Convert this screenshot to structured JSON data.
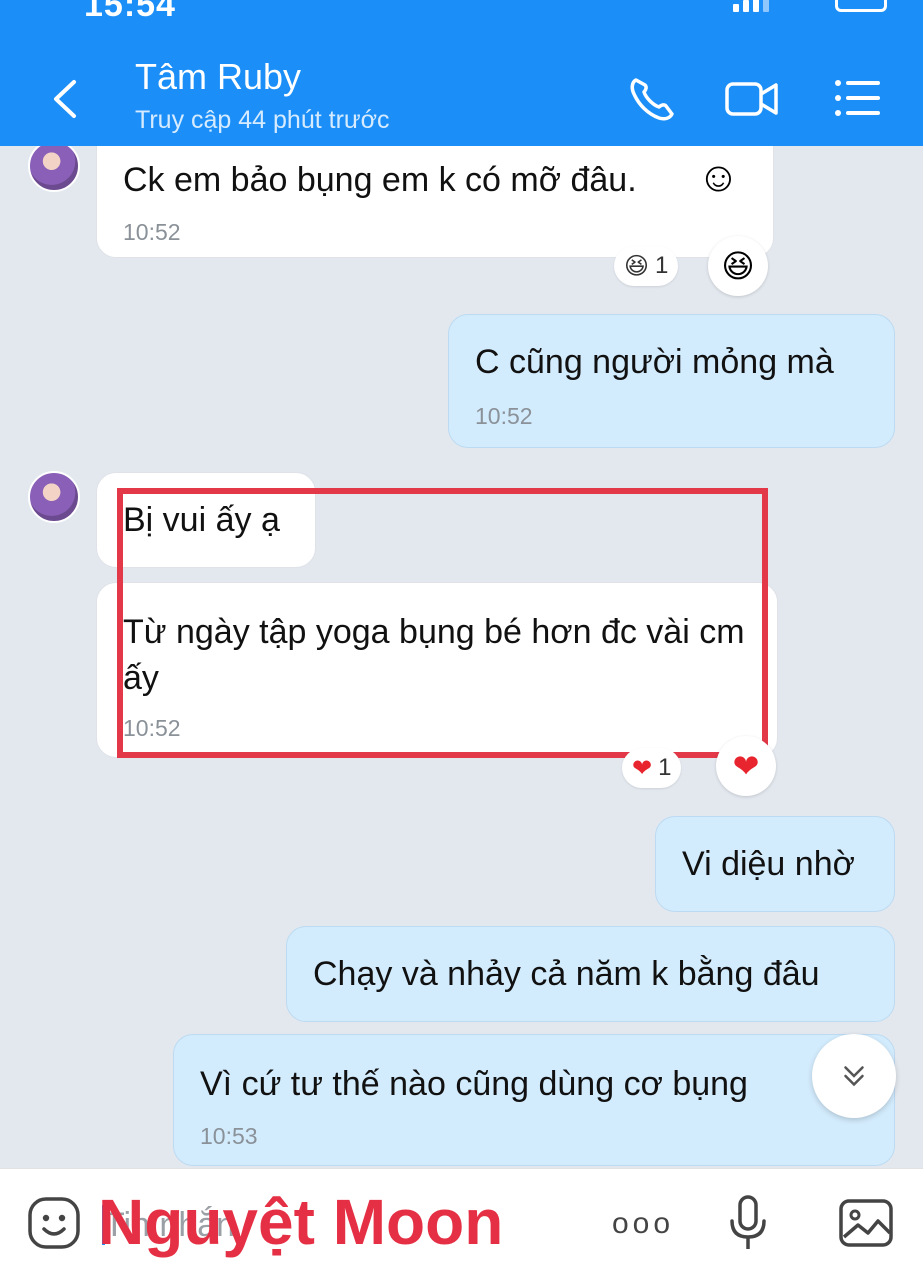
{
  "status": {
    "time": "15:54"
  },
  "header": {
    "contact_name": "Tâm Ruby",
    "last_seen": "Truy cập 44 phút trước"
  },
  "messages": [
    {
      "from": "them",
      "text": "Ck em bảo bụng em k có mỡ đâu.",
      "time": "10:52",
      "reaction_count": "1"
    },
    {
      "from": "me",
      "text": "C cũng người mỏng mà",
      "time": "10:52"
    },
    {
      "from": "them",
      "text": "Bị vui ấy ạ"
    },
    {
      "from": "them",
      "text": "Từ ngày tập yoga bụng bé hơn đc vài cm ấy",
      "time": "10:52",
      "reaction_count": "1"
    },
    {
      "from": "me",
      "text": "Vi diệu nhờ"
    },
    {
      "from": "me",
      "text": "Chạy và nhảy cả năm k bằng đâu"
    },
    {
      "from": "me",
      "text": "Vì cứ tư thế nào cũng dùng cơ bụng",
      "time": "10:53"
    }
  ],
  "composer": {
    "placeholder": "Tin nhắn",
    "watermark": "Nguyệt Moon",
    "more": "ooo"
  },
  "colors": {
    "header": "#1b8ff7",
    "outgoing": "#d3ecfd",
    "incoming": "#ffffff",
    "highlight": "#e23848",
    "watermark": "#e52f44"
  },
  "icons": [
    "back-arrow-icon",
    "phone-icon",
    "video-call-icon",
    "menu-list-icon",
    "emoji-icon",
    "more-icon",
    "microphone-icon",
    "image-icon",
    "chevron-down-icon"
  ]
}
